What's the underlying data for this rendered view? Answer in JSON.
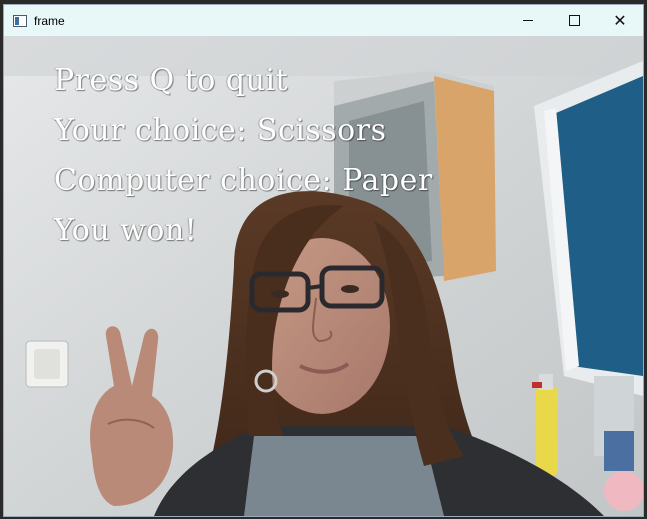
{
  "window": {
    "title": "frame",
    "controls": {
      "minimize_icon": "minimize-icon",
      "maximize_icon": "maximize-icon",
      "close_icon": "close-icon",
      "close_glyph": "✕"
    }
  },
  "overlay": {
    "line1": "Press Q to quit",
    "line2": "Your choice: Scissors",
    "line3": "Computer choice: Paper",
    "line4": "You won!"
  },
  "colors": {
    "titlebar": "#e8f7f7",
    "overlay_text": "#ffffff",
    "wall": "#d9dbdc",
    "door_blue": "#1f5e86",
    "cabinet_wood": "#d8a46a"
  }
}
